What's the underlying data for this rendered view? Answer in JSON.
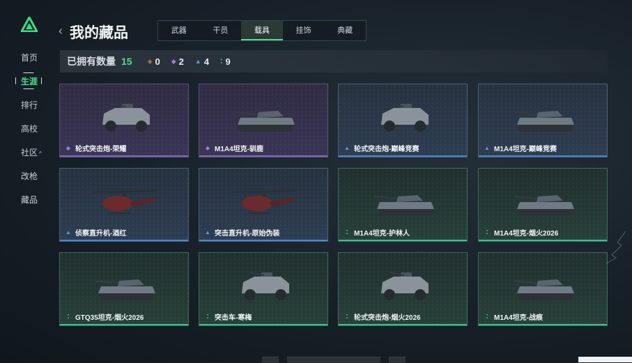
{
  "colors": {
    "accent": "#4ee08a",
    "purple": "#7e6ab8",
    "blue": "#4d86c8",
    "green": "#3fbf8c",
    "orange": "#e07a3a"
  },
  "sidebar": {
    "items": [
      {
        "label": "首页"
      },
      {
        "label": "生涯"
      },
      {
        "label": "排行"
      },
      {
        "label": "高校"
      },
      {
        "label": "社区",
        "arrow": "^"
      },
      {
        "label": "改枪"
      },
      {
        "label": "藏品"
      }
    ]
  },
  "header": {
    "back_icon": "‹",
    "title": "我的藏品"
  },
  "tabs": [
    {
      "label": "武器"
    },
    {
      "label": "干员"
    },
    {
      "label": "载具"
    },
    {
      "label": "挂饰"
    },
    {
      "label": "典藏"
    }
  ],
  "stats": {
    "owned_label": "已拥有数量",
    "owned_count": "15",
    "orange": "0",
    "purple": "2",
    "blue": "4",
    "green": "9"
  },
  "cards": [
    {
      "name": "轮式突击炮-荣耀",
      "rarity": "purple",
      "vehicle": "armored-car-icon"
    },
    {
      "name": "M1A4坦克-驯鹿",
      "rarity": "purple",
      "vehicle": "tank-icon"
    },
    {
      "name": "轮式突击炮-巅峰竞赛",
      "rarity": "blue",
      "vehicle": "armored-car-icon"
    },
    {
      "name": "M1A4坦克-巅峰竞赛",
      "rarity": "blue",
      "vehicle": "tank-icon"
    },
    {
      "name": "侦察直升机-酒红",
      "rarity": "blue",
      "vehicle": "helicopter-icon"
    },
    {
      "name": "突击直升机-原始伪装",
      "rarity": "blue",
      "vehicle": "helicopter-icon"
    },
    {
      "name": "M1A4坦克-护林人",
      "rarity": "green",
      "vehicle": "tank-icon"
    },
    {
      "name": "M1A4坦克-烟火2026",
      "rarity": "green",
      "vehicle": "tank-icon"
    },
    {
      "name": "GTQ35坦克-烟火2026",
      "rarity": "green",
      "vehicle": "tank-icon"
    },
    {
      "name": "突击车-寒梅",
      "rarity": "green",
      "vehicle": "armored-car-icon"
    },
    {
      "name": "轮式突击炮-烟火2026",
      "rarity": "green",
      "vehicle": "armored-car-icon"
    },
    {
      "name": "M1A4坦克-战痕",
      "rarity": "green",
      "vehicle": "tank-icon"
    }
  ]
}
